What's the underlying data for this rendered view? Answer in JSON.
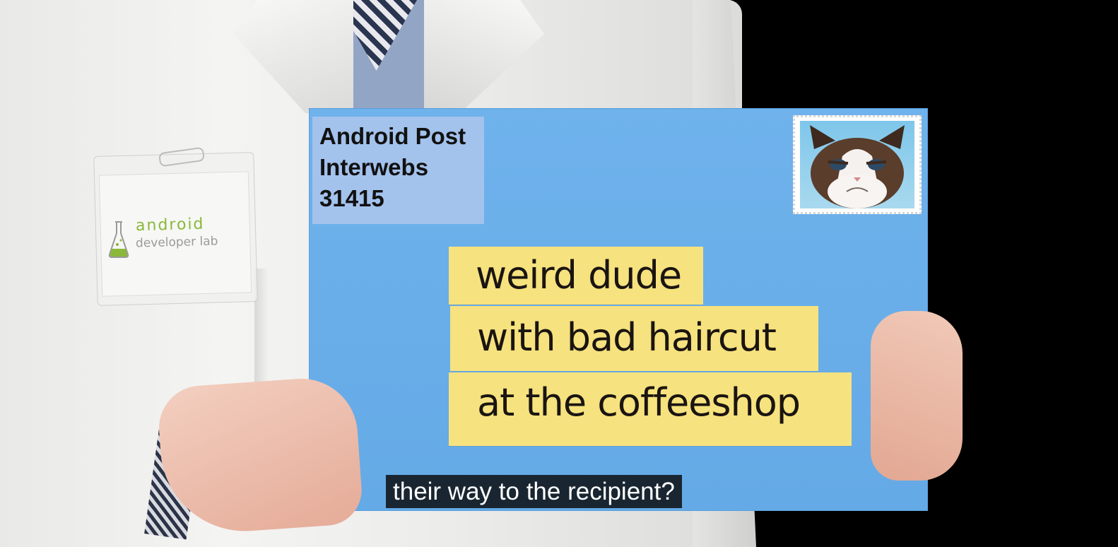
{
  "badge": {
    "logo_text": "android",
    "sub_text": "developer lab",
    "icon": "flask-icon"
  },
  "envelope": {
    "return_address": [
      "Android Post",
      "Interwebs",
      "31415"
    ],
    "stamp": "grumpy-cat-stamp-icon",
    "recipient_lines": [
      "weird dude",
      "with bad haircut",
      "at the coffeeshop"
    ]
  },
  "caption": {
    "text": "their way to the recipient?"
  },
  "colors": {
    "envelope": "#6fb2ec",
    "label": "#f6e27e",
    "return_label": "#a3c2ec",
    "android_green": "#8ab83a"
  }
}
